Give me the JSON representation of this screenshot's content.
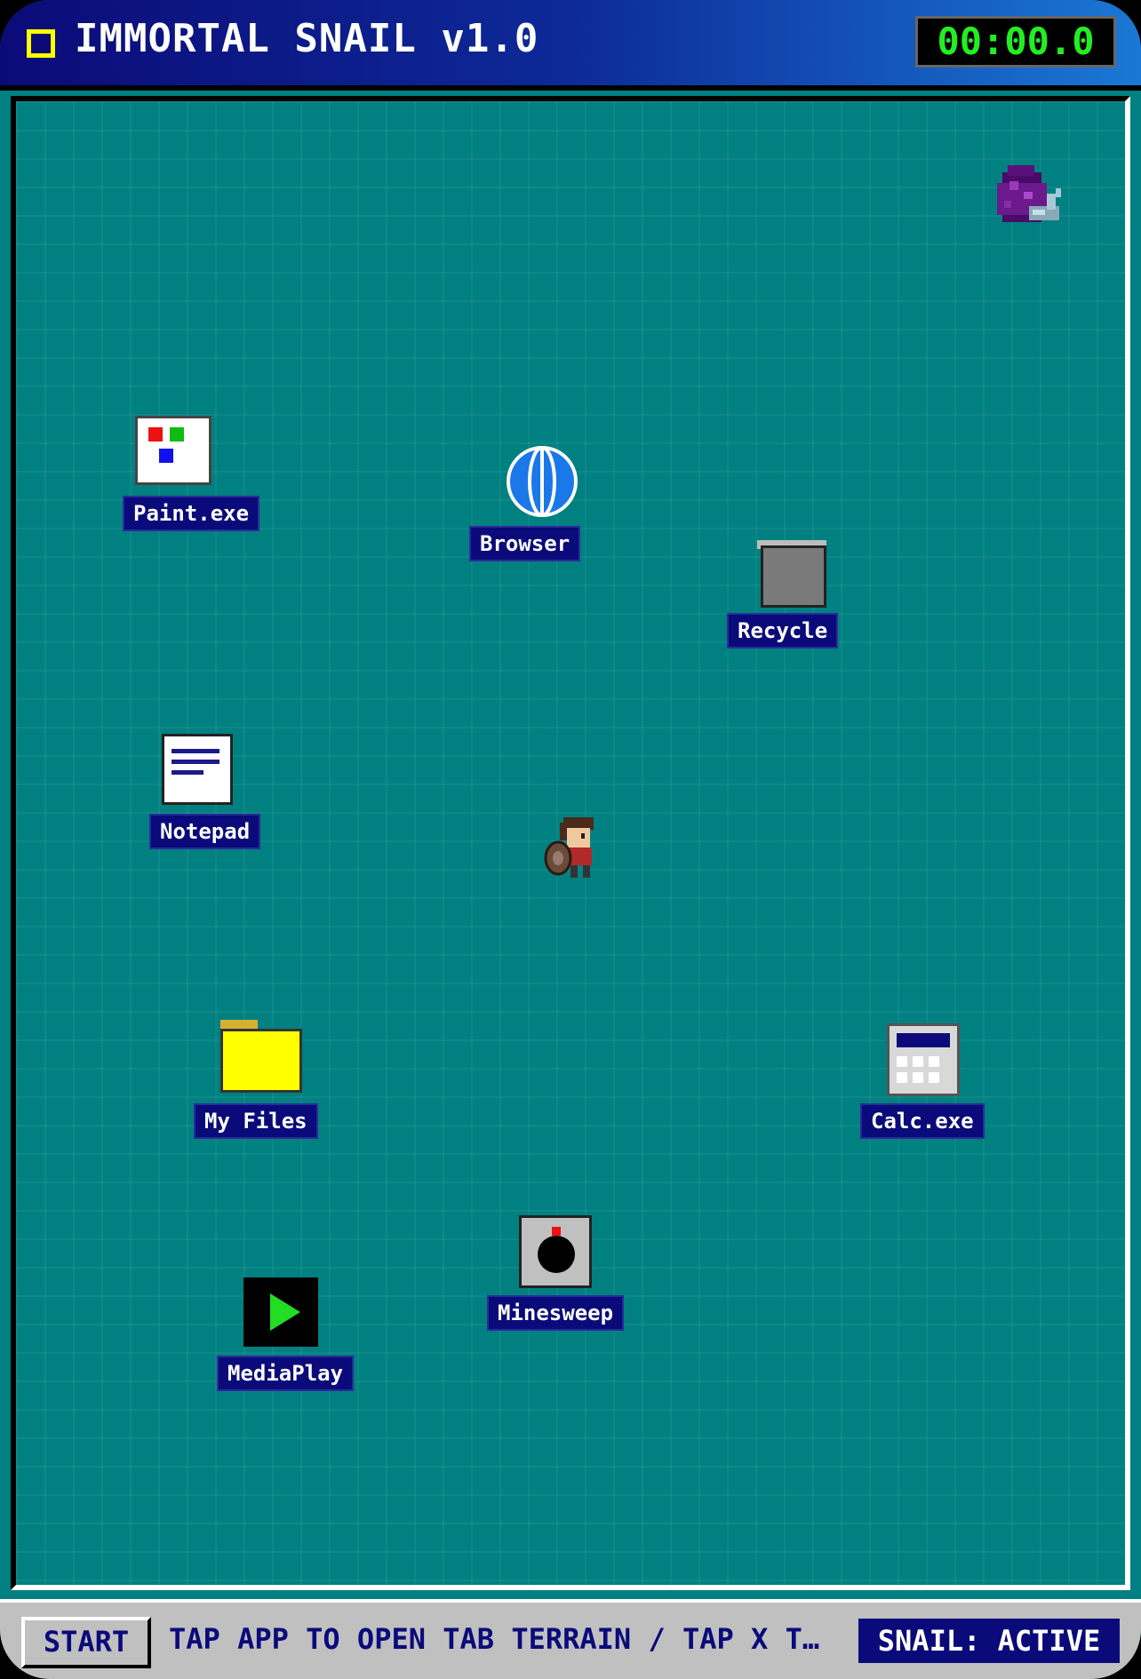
{
  "title_bar": {
    "title": "IMMORTAL SNAIL v1.0",
    "timer": "00:00.0"
  },
  "desktop": {
    "apps": [
      {
        "id": "paint",
        "label": "Paint.exe",
        "icon": "paint-icon"
      },
      {
        "id": "browser",
        "label": "Browser",
        "icon": "globe-icon"
      },
      {
        "id": "recycle",
        "label": "Recycle",
        "icon": "trash-icon"
      },
      {
        "id": "notepad",
        "label": "Notepad",
        "icon": "document-icon"
      },
      {
        "id": "myfiles",
        "label": "My Files",
        "icon": "folder-icon"
      },
      {
        "id": "calc",
        "label": "Calc.exe",
        "icon": "calculator-icon"
      },
      {
        "id": "minesweep",
        "label": "Minesweep",
        "icon": "bomb-icon"
      },
      {
        "id": "mediaplay",
        "label": "MediaPlay",
        "icon": "play-icon"
      }
    ],
    "sprites": {
      "snail": "snail-sprite",
      "player": "player-sprite"
    }
  },
  "taskbar": {
    "start_label": "START",
    "ticker": "TAP APP TO OPEN TAB TERRAIN / TAP X T…",
    "status": "SNAIL: ACTIVE"
  },
  "colors": {
    "desktop": "#008080",
    "label_bg": "#0a0a7a",
    "timer_text": "#22ee22",
    "title_accent": "#ffff00"
  }
}
